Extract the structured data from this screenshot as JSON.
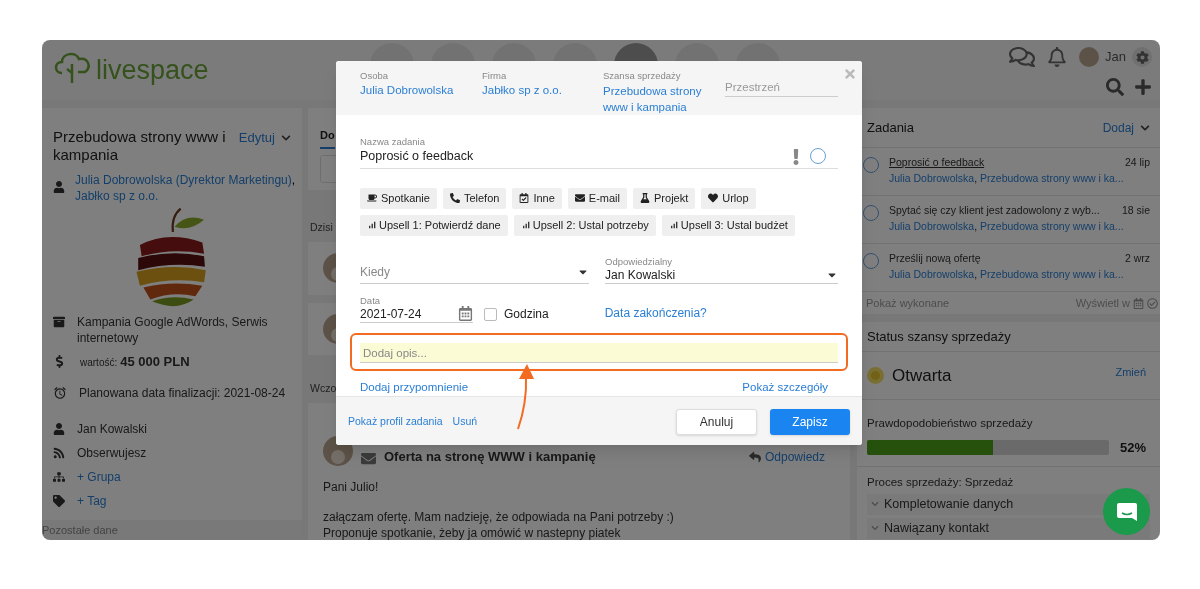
{
  "app": {
    "logo": "livespace",
    "nav": [
      {
        "selected": false
      },
      {
        "selected": false
      },
      {
        "selected": false
      },
      {
        "selected": false
      },
      {
        "selected": true
      },
      {
        "selected": false
      },
      {
        "selected": false
      }
    ],
    "user": "Jan"
  },
  "deal": {
    "title": "Przebudowa strony www i kampania",
    "edit": "Edytuj",
    "contact": "Julia Dobrowolska (Dyrektor Marketingu)",
    "separator": ",",
    "company": "Jabłko sp z o.o.",
    "products": "Kampania Google AdWords, Serwis internetowy",
    "value_label": "wartość:",
    "value": "45 000 PLN",
    "close_date": "Planowana data finalizacji: 2021-08-24",
    "owner": "Jan Kowalski",
    "following": "Obserwujesz",
    "add_group": "+ Grupa",
    "add_tag": "+ Tag",
    "more": "Pozostałe dane"
  },
  "feed": {
    "tab": "Do",
    "today": "Dzisi",
    "yesterday": "Wczo",
    "email": {
      "subject": "Oferta na stronę WWW i kampanię",
      "reply": "Odpowiedz",
      "body": [
        "Pani Julio!",
        "załączam ofertę. Mam nadzieję, że odpowiada na Pani potrzeby :)",
        "Proponuje spotkanie, żeby ja omówić w nastepny piatek"
      ]
    }
  },
  "tasks": {
    "title": "Zadania",
    "add": "Dodaj",
    "items": [
      {
        "title": "Poprosić o feedback",
        "date": "24 lip",
        "person": "Julia Dobrowolska",
        "separator": ",",
        "deal": "Przebudowa strony www i ka...",
        "selected": true,
        "done": false
      },
      {
        "title": "Spytać się czy klient jest zadowolony z wyb...",
        "date": "18 sie",
        "person": "Julia Dobrowolska",
        "separator": ",",
        "deal": "Przebudowa strony www i ka...",
        "selected": false,
        "done": false
      },
      {
        "title": "Prześlij nową ofertę",
        "date": "2 wrz",
        "person": "Julia Dobrowolska",
        "separator": ",",
        "deal": "Przebudowa strony www i ka...",
        "selected": false,
        "done": false
      }
    ],
    "show_done": "Pokaż wykonane",
    "view_in": "Wyświetl w"
  },
  "status": {
    "title": "Status szansy sprzedaży",
    "state": "Otwarta",
    "change": "Zmień",
    "probability_label": "Prawdopodobieństwo sprzedaży",
    "level": 0.52,
    "percent": "52%",
    "process": "Proces sprzedaży: Sprzedaż",
    "stages": [
      "Kompletowanie danych",
      "Nawiązany kontakt"
    ]
  },
  "modal": {
    "person_label": "Osoba",
    "person": "Julia Dobrowolska",
    "company_label": "Firma",
    "company": "Jabłko sp z o.o.",
    "deal_label": "Szansa sprzedaży",
    "deal": "Przebudowa strony www i kampania",
    "space_placeholder": "Przestrzeń",
    "name_label": "Nazwa zadania",
    "name": "Poprosić o feedback",
    "done": false,
    "types": [
      "Spotkanie",
      "Telefon",
      "Inne",
      "E-mail",
      "Projekt",
      "Urlop"
    ],
    "upsells": [
      "Upsell 1: Potwierdź dane",
      "Upsell 2: Ustal potrzeby",
      "Upsell 3: Ustal budżet"
    ],
    "when_placeholder": "Kiedy",
    "owner_label": "Odpowiedzialny",
    "owner": "Jan Kowalski",
    "date_label": "Data",
    "date": "2021-07-24",
    "time_label": "Godzina",
    "time_checked": false,
    "end_date": "Data zakończenia?",
    "description_placeholder": "Dodaj opis...",
    "add_reminder": "Dodaj przypomnienie",
    "show_details": "Pokaż szczegóły",
    "show_profile": "Pokaż profil zadania",
    "delete": "Usuń",
    "cancel": "Anuluj",
    "save": "Zapisz"
  }
}
